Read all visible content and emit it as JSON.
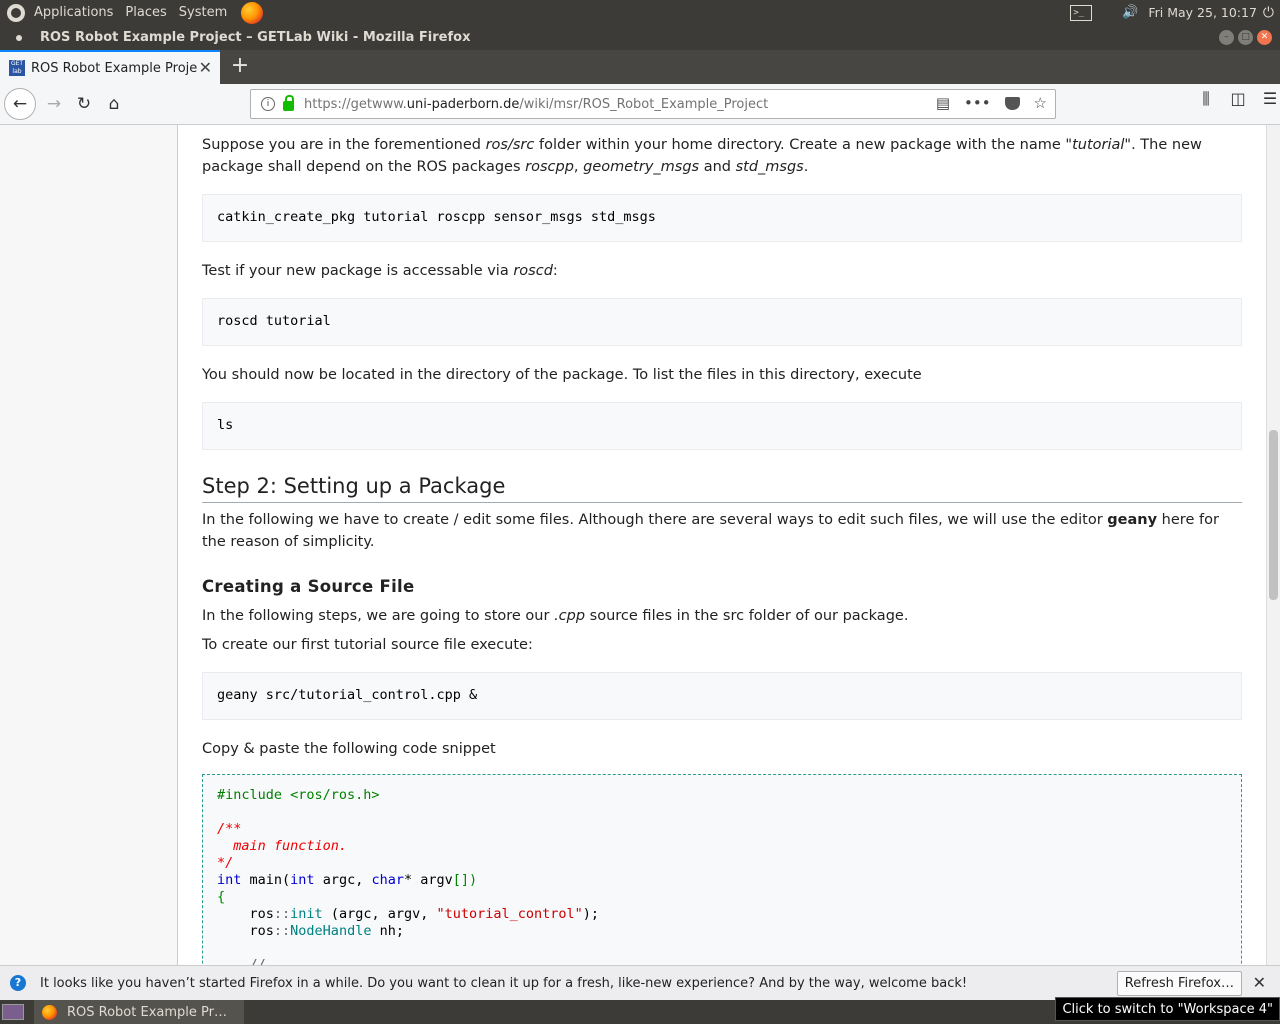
{
  "panel": {
    "menus": [
      "Applications",
      "Places",
      "System"
    ],
    "clock": "Fri May 25, 10:17"
  },
  "window": {
    "title": "ROS Robot Example Project – GETLab Wiki - Mozilla Firefox"
  },
  "tab": {
    "label": "ROS Robot Example Project",
    "favicon_text": "GET lab"
  },
  "url": {
    "prefix": "https://getwww.",
    "host": "uni-paderborn.de",
    "path": "/wiki/msr/ROS_Robot_Example_Project"
  },
  "content": {
    "p1_a": "Suppose you are in the forementioned ",
    "p1_em1": "ros/src",
    "p1_b": " folder within your home directory. Create a new package with the name \"",
    "p1_em2": "tutorial",
    "p1_c": "\". The new package shall depend on the ROS packages ",
    "p1_em3": "roscpp",
    "p1_d": ", ",
    "p1_em4": "geometry_msgs",
    "p1_e": " and ",
    "p1_em5": "std_msgs",
    "p1_f": ".",
    "code1": "catkin_create_pkg tutorial roscpp sensor_msgs std_msgs",
    "p2_a": "Test if your new package is accessable via ",
    "p2_em": "roscd",
    "p2_b": ":",
    "code2": "roscd tutorial",
    "p3": "You should now be located in the directory of the package. To list the files in this directory, execute",
    "code3": "ls",
    "h2": "Step 2: Setting up a Package",
    "p4_a": "In the following we have to create / edit some files. Although there are several ways to edit such files, we will use the editor ",
    "p4_b": "geany",
    "p4_c": " here for the reason of simplicity.",
    "h3": "Creating a Source File",
    "p5_a": "In the following steps, we are going to store our ",
    "p5_em": ".cpp",
    "p5_b": " source files in the src folder of our package.",
    "p6": "To create our first tutorial source file execute:",
    "code4": "geany src/tutorial_control.cpp &",
    "p7": "Copy & paste the following code snippet",
    "snippet": {
      "l1": "#include <ros/ros.h>",
      "l3": "/**",
      "l4": "  main function.",
      "l5": "*/",
      "l6_kw1": "int",
      "l6_a": " main(",
      "l6_kw2": "int",
      "l6_b": " argc, ",
      "l6_kw3": "char",
      "l6_c": "* argv",
      "l6_d": "[])",
      "l7": "{",
      "l8_a": "    ros",
      "l8_op": "::",
      "l8_fn": "init",
      "l8_b": " (argc, argv, ",
      "l8_str": "\"tutorial_control\"",
      "l8_c": ");",
      "l9_a": "    ros",
      "l9_op": "::",
      "l9_fn": "NodeHandle",
      "l9_b": " nh;",
      "l11": "    // ............"
    }
  },
  "notification": {
    "message": "It looks like you haven’t started Firefox in a while. Do you want to clean it up for a fresh, like-new experience? And by the way, welcome back!",
    "button": "Refresh Firefox…"
  },
  "taskbar": {
    "task_label": "ROS Robot Example Pr…",
    "tooltip": "Click to switch to \"Workspace 4\""
  }
}
